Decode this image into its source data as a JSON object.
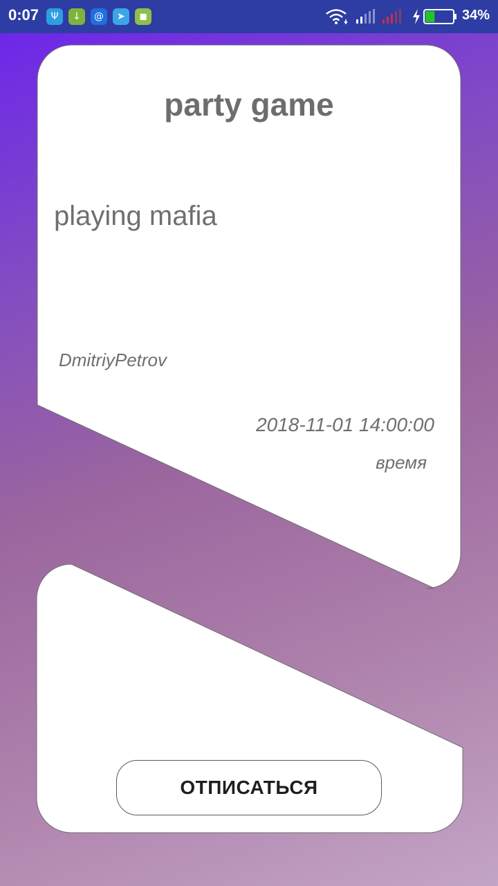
{
  "status_bar": {
    "time": "0:07",
    "battery_percent": "34%",
    "battery_level": 0.34,
    "notification_icons": [
      "usb-debug-icon",
      "download-icon",
      "mail-icon",
      "telegram-icon",
      "android-icon"
    ],
    "system_icons": [
      "wifi-icon",
      "signal-icon",
      "signal-no-service-icon",
      "charging-icon",
      "battery-icon"
    ]
  },
  "event": {
    "title": "party game",
    "description": "playing mafia",
    "author": "DmitriyPetrov",
    "datetime": "2018-11-01 14:00:00",
    "datetime_label": "время"
  },
  "actions": {
    "unsubscribe_label": "ОТПИСАТЬСЯ"
  },
  "colors": {
    "status_bar": "#2d3da4",
    "gradient_start": "#6a22ee",
    "gradient_end": "#c3a4c6",
    "card": "#ffffff",
    "text": "#6d6d6d"
  }
}
